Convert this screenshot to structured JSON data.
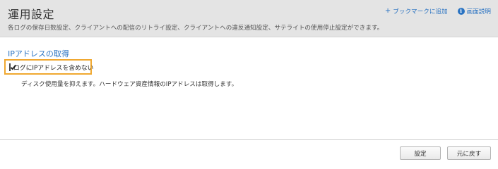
{
  "header": {
    "title": "運用設定",
    "description": "各ログの保存日数設定、クライアントへの配信のリトライ設定、クライアントへの違反通知設定、サテライトの使用停止設定ができます。",
    "bookmark_link": "ブックマークに追加",
    "help_link": "画面説明",
    "icons": {
      "bookmark": "plus-icon",
      "help": "info-icon"
    }
  },
  "section": {
    "title": "IPアドレスの取得",
    "checkbox_label": "ログにIPアドレスを含めない",
    "checkbox_checked": true,
    "help_text": "ディスク使用量を抑えます。ハードウェア資産情報のIPアドレスは取得します。"
  },
  "footer": {
    "save_label": "設定",
    "reset_label": "元に戻す"
  },
  "colors": {
    "accent": "#2a73c2",
    "highlight_border": "#f0a830",
    "header_bg": "#e4e4e4"
  }
}
